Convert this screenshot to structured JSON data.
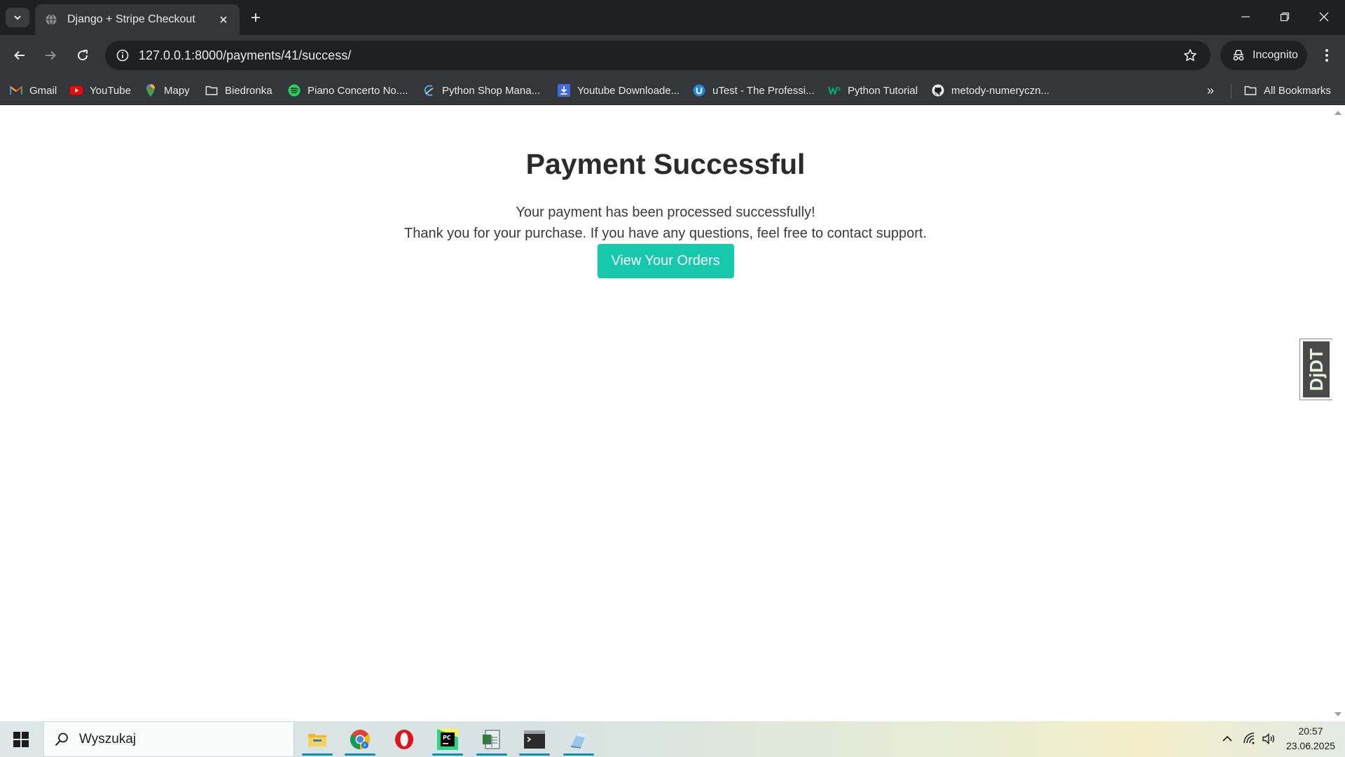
{
  "browser": {
    "tab_title": "Django + Stripe Checkout",
    "url": "127.0.0.1:8000/payments/41/success/",
    "profile_label": "Incognito"
  },
  "bookmarks": {
    "items": [
      {
        "label": "Gmail",
        "icon": "gmail-icon"
      },
      {
        "label": "YouTube",
        "icon": "youtube-icon"
      },
      {
        "label": "Mapy",
        "icon": "maps-icon"
      },
      {
        "label": "Biedronka",
        "icon": "folder-icon"
      },
      {
        "label": "Piano Concerto No....",
        "icon": "spotify-icon"
      },
      {
        "label": "Python Shop Mana...",
        "icon": "python-shop-icon"
      },
      {
        "label": "Youtube Downloade...",
        "icon": "download-icon"
      },
      {
        "label": "uTest - The Professi...",
        "icon": "utest-icon"
      },
      {
        "label": "Python Tutorial",
        "icon": "w3schools-icon"
      },
      {
        "label": "metody-numeryczn...",
        "icon": "github-icon"
      }
    ],
    "all_bookmarks_label": "All Bookmarks"
  },
  "page": {
    "heading": "Payment Successful",
    "message_line1": "Your payment has been processed successfully!",
    "message_line2": "Thank you for your purchase. If you have any questions, feel free to contact support.",
    "button_label": "View Your Orders",
    "debug_toolbar_label": "DjDT"
  },
  "taskbar": {
    "search_placeholder": "Wyszukaj",
    "apps": [
      "file-explorer-icon",
      "chrome-icon",
      "opera-icon",
      "pycharm-icon",
      "spreadsheet-icon",
      "terminal-icon",
      "notes-icon"
    ],
    "time": "20:57",
    "date": "23.06.2025"
  },
  "colors": {
    "accent_button": "#16c9ad",
    "browser_dark": "#35363a",
    "tab_strip": "#1f2023"
  }
}
